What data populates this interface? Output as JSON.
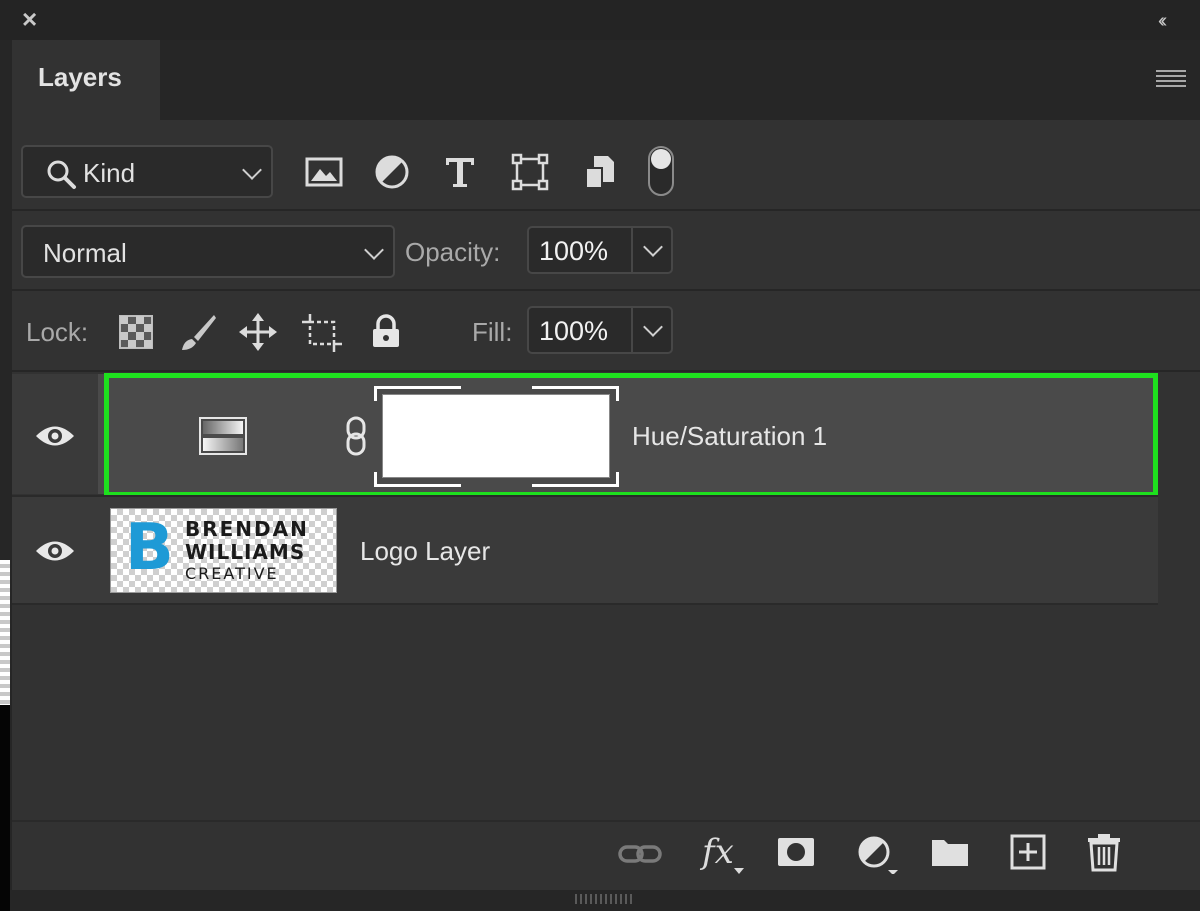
{
  "panel": {
    "tab_label": "Layers",
    "close_label": "×",
    "collapse_label": "‹‹"
  },
  "filter": {
    "kind_label": "Kind",
    "icons": [
      "image-filter-icon",
      "adjustment-filter-icon",
      "type-filter-icon",
      "shape-filter-icon",
      "smart-object-filter-icon"
    ],
    "toggle_on": true
  },
  "blend": {
    "mode": "Normal",
    "opacity_label": "Opacity:",
    "opacity_value": "100%"
  },
  "lock": {
    "label": "Lock:",
    "icons": [
      "lock-transparent-pixels-icon",
      "lock-image-pixels-icon",
      "lock-position-icon",
      "lock-artboard-icon",
      "lock-all-icon"
    ],
    "fill_label": "Fill:",
    "fill_value": "100%"
  },
  "layers": [
    {
      "name": "Hue/Saturation 1",
      "visible": true,
      "selected": true,
      "type": "adjustment"
    },
    {
      "name": "Logo Layer",
      "visible": true,
      "selected": false,
      "type": "pixel"
    }
  ],
  "logo": {
    "line1": "BRENDAN",
    "line2": "WILLIAMS",
    "line3": "CREATIVE",
    "mark": "B",
    "mark_color": "#1e9ad6"
  },
  "bottom_icons": [
    "link-layers-icon",
    "fx-icon",
    "add-mask-icon",
    "new-adjustment-icon",
    "new-group-icon",
    "new-layer-icon",
    "delete-icon"
  ],
  "fx_label": "fx",
  "colors": {
    "selection_outline": "#1ee01e",
    "panel_bg": "#323232"
  }
}
